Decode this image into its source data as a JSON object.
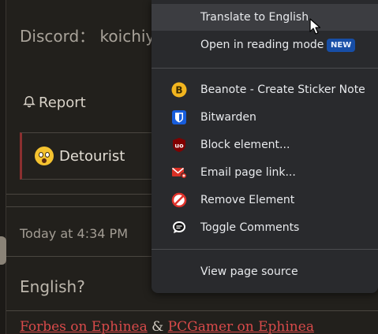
{
  "page": {
    "discord_line": "Discord： koichiy",
    "report_label": "Report",
    "user_name": "Detourist",
    "timestamp": "Today at 4:34 PM",
    "message": "English?",
    "links": {
      "first": "Forbes on Ephinea",
      "separator": " & ",
      "second": "PCGamer on Ephinea"
    }
  },
  "context_menu": {
    "items": [
      {
        "label": "Translate to English",
        "icon": "none"
      },
      {
        "label": "Open in reading mode",
        "icon": "none",
        "badge": "NEW"
      },
      {
        "label": "Beanote - Create Sticker Note",
        "icon": "beanote-icon"
      },
      {
        "label": "Bitwarden",
        "icon": "bitwarden-icon"
      },
      {
        "label": "Block element...",
        "icon": "ublock-icon"
      },
      {
        "label": "Email page link...",
        "icon": "email-icon"
      },
      {
        "label": "Remove Element",
        "icon": "remove-icon"
      },
      {
        "label": "Toggle Comments",
        "icon": "comments-icon"
      },
      {
        "label": "View page source",
        "icon": "none"
      }
    ]
  },
  "colors": {
    "menu_bg": "#292a2d",
    "menu_hover": "#3c3d41",
    "badge_bg": "#174ea6",
    "link_red": "#d84a4a"
  }
}
